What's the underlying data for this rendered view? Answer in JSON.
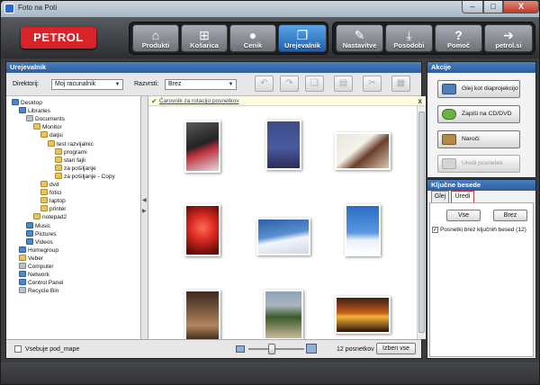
{
  "window": {
    "title": "Foto na Poti",
    "min": "–",
    "max": "□",
    "close": "X"
  },
  "brand": {
    "logo": "PETROL",
    "color": "#d8232a"
  },
  "nav": {
    "items": [
      {
        "label": "Produkti",
        "icon": "home-icon",
        "glyph": "⌂",
        "active": false
      },
      {
        "label": "Košarica",
        "icon": "basket-icon",
        "glyph": "🧺",
        "active": false
      },
      {
        "label": "Cenik",
        "icon": "piggy-bank-icon",
        "glyph": "🐖",
        "active": false
      },
      {
        "label": "Urejevalnik",
        "icon": "editor-windows-icon",
        "glyph": "❐",
        "active": true
      },
      {
        "label": "Nastavitve",
        "icon": "wrench-icon",
        "glyph": "🔧",
        "active": false
      },
      {
        "label": "Posodobi",
        "icon": "download-icon",
        "glyph": "⤓",
        "active": false
      },
      {
        "label": "Pomoč",
        "icon": "question-icon",
        "glyph": "?",
        "active": false
      },
      {
        "label": "petrol.si",
        "icon": "arrow-right-icon",
        "glyph": "➔",
        "active": false
      }
    ]
  },
  "editor": {
    "title": "Urejevalnik",
    "directory_label": "Direktorij:",
    "directory_value": "Moj racunalnik",
    "sort_label": "Razvrsti:",
    "sort_value": "Brez",
    "tools": [
      "undo-icon",
      "redo-icon",
      "copy-icon",
      "paste-icon",
      "cut-icon",
      "edit-icon"
    ],
    "tree": [
      {
        "label": "Desktop",
        "level": 0,
        "type": "blue"
      },
      {
        "label": "Libraries",
        "level": 1,
        "type": "blue"
      },
      {
        "label": "Documents",
        "level": 2,
        "type": "grey"
      },
      {
        "label": "Monitor",
        "level": 3,
        "type": "fold"
      },
      {
        "label": "daljsi",
        "level": 4,
        "type": "fold"
      },
      {
        "label": "test razvijalnic",
        "level": 5,
        "type": "fold"
      },
      {
        "label": "programi",
        "level": 6,
        "type": "fold"
      },
      {
        "label": "stari fajli",
        "level": 6,
        "type": "fold"
      },
      {
        "label": "za pošiljanje",
        "level": 6,
        "type": "fold"
      },
      {
        "label": "za pošiljanje - Copy",
        "level": 6,
        "type": "fold"
      },
      {
        "label": "dvd",
        "level": 4,
        "type": "fold"
      },
      {
        "label": "fotici",
        "level": 4,
        "type": "fold"
      },
      {
        "label": "laptop",
        "level": 4,
        "type": "fold"
      },
      {
        "label": "printer",
        "level": 4,
        "type": "fold"
      },
      {
        "label": "notepad2",
        "level": 3,
        "type": "fold"
      },
      {
        "label": "Music",
        "level": 2,
        "type": "blue"
      },
      {
        "label": "Pictures",
        "level": 2,
        "type": "blue"
      },
      {
        "label": "Videos",
        "level": 2,
        "type": "blue"
      },
      {
        "label": "Homegroup",
        "level": 1,
        "type": "blue"
      },
      {
        "label": "Veber",
        "level": 1,
        "type": "fold"
      },
      {
        "label": "Computer",
        "level": 1,
        "type": "grey"
      },
      {
        "label": "Network",
        "level": 1,
        "type": "blue"
      },
      {
        "label": "Control Panel",
        "level": 1,
        "type": "blue"
      },
      {
        "label": "Recycle Bin",
        "level": 1,
        "type": "grey"
      }
    ],
    "wizard_link": "Čarovnik za rotacijo posnetkov",
    "include_subfolders": "Vsebuje pod_mape",
    "photo_count": "12 posnetkov",
    "select_all": "Izberi vse"
  },
  "actions": {
    "title": "Akcije",
    "buttons": [
      {
        "label": "Glej kot diaprojekcijo",
        "icon": "slideshow-icon",
        "enabled": true
      },
      {
        "label": "Zapiši na CD/DVD",
        "icon": "burn-disc-icon",
        "enabled": true
      },
      {
        "label": "Naroči",
        "icon": "order-icon",
        "enabled": true
      },
      {
        "label": "Uredi posnetek",
        "icon": "edit-photo-icon",
        "enabled": false
      }
    ]
  },
  "keywords": {
    "title": "Ključne besede",
    "tab_view": "Glej",
    "tab_edit": "Uredi",
    "all_button": "Vse",
    "none_button": "Brez",
    "item": "Posnetki brez ključnih besed (12)"
  }
}
